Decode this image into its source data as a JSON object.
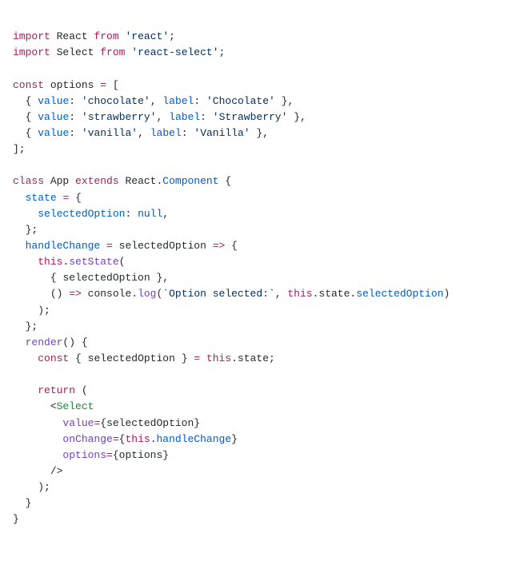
{
  "code": {
    "lang": "javascript-react",
    "imports": [
      {
        "name": "React",
        "from": "react"
      },
      {
        "name": "Select",
        "from": "react-select"
      }
    ],
    "options": [
      {
        "value": "chocolate",
        "label": "Chocolate"
      },
      {
        "value": "strawberry",
        "label": "Strawberry"
      },
      {
        "value": "vanilla",
        "label": "Vanilla"
      }
    ],
    "class_name": "App",
    "extends": "React.Component",
    "state_field": "selectedOption",
    "state_initial": "null",
    "handler_name": "handleChange",
    "handler_param": "selectedOption",
    "setstate_key": "selectedOption",
    "log_prefix": "Option selected:",
    "log_expr": "this.state.selectedOption",
    "render_destructure": "selectedOption",
    "render_source": "this.state",
    "jsx_component": "Select",
    "jsx_props": {
      "value": "selectedOption",
      "onChange": "this.handleChange",
      "options": "options"
    }
  },
  "tokens": {
    "import": "import",
    "from": "from",
    "const": "const",
    "class": "class",
    "extends": "extends",
    "this": "this",
    "return": "return",
    "null": "null",
    "render": "render",
    "state": "state",
    "value": "value",
    "label": "label",
    "setState": "setState",
    "console": "console",
    "log": "log",
    "options_ident": "options",
    "onChange": "onChange"
  }
}
